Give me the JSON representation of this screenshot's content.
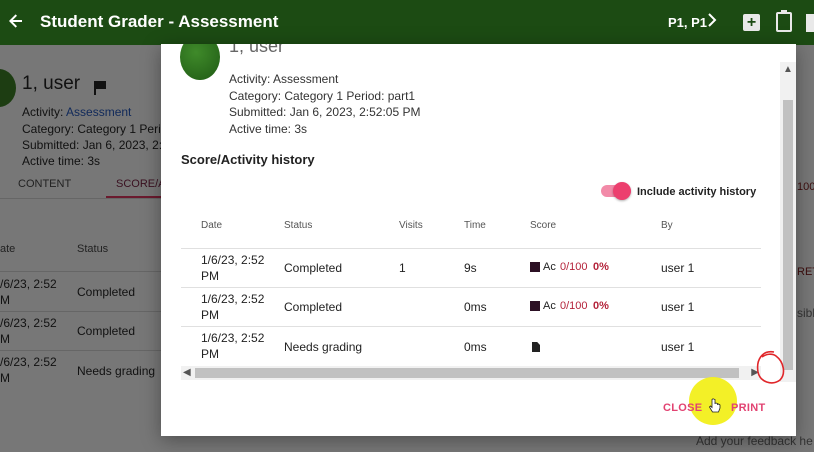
{
  "appbar": {
    "title": "Student Grader - Assessment",
    "period": "P1, P1",
    "icons": [
      "arrow-back-icon",
      "chevron-right-icon",
      "add-box-icon",
      "clipboard-icon"
    ]
  },
  "background": {
    "student_name": "1, user",
    "activity_label": "Activity:",
    "activity_link": "Assessment",
    "category_line": "Category: Category 1   Perio",
    "submitted_line": "Submitted: Jan 6, 2023, 2:5",
    "active_line": "Active time:  3s",
    "tabs": [
      "CONTENT",
      "SCORE/AC"
    ],
    "table_headers": [
      "ate",
      "Status"
    ],
    "rows": [
      {
        "date1": "/6/23, 2:52",
        "date2": "M",
        "status": "Completed"
      },
      {
        "date1": "/6/23, 2:52",
        "date2": "M",
        "status": "Completed"
      },
      {
        "date1": "/6/23, 2:52",
        "date2": "M",
        "status": "Needs grading"
      }
    ],
    "right_fragments": {
      "score": "100",
      "retry": "RET",
      "visible": "sible"
    },
    "feedback_placeholder": "Add your feedback he"
  },
  "dialog": {
    "student_name": "1, user",
    "activity": "Activity: Assessment",
    "category_period": "Category: Category 1   Period: part1",
    "submitted": "Submitted: Jan 6, 2023, 2:52:05 PM",
    "active_time": "Active time:  3s",
    "section_title": "Score/Activity history",
    "toggle_label": "Include activity history",
    "toggle_on": true,
    "columns": [
      "Date",
      "Status",
      "Visits",
      "Time",
      "Score",
      "By"
    ],
    "rows": [
      {
        "date1": "1/6/23, 2:52",
        "date2": "PM",
        "status": "Completed",
        "visits": "1",
        "time": "9s",
        "score_ac": "Ac",
        "score_val": "0/100",
        "score_pct": "0%",
        "by": "user 1"
      },
      {
        "date1": "1/6/23, 2:52",
        "date2": "PM",
        "status": "Completed",
        "visits": "",
        "time": "0ms",
        "score_ac": "Ac",
        "score_val": "0/100",
        "score_pct": "0%",
        "by": "user 1"
      },
      {
        "date1": "1/6/23, 2:52",
        "date2": "PM",
        "status": "Needs grading",
        "visits": "",
        "time": "0ms",
        "score_ac": "",
        "score_val": "",
        "score_pct": "",
        "by": "user 1"
      }
    ],
    "buttons": {
      "close": "CLOSE",
      "print": "PRINT"
    }
  },
  "colors": {
    "appbar": "#1c4b13",
    "accent": "#e24372",
    "toggle": "#ec3f6e",
    "score": "#b4233a"
  }
}
